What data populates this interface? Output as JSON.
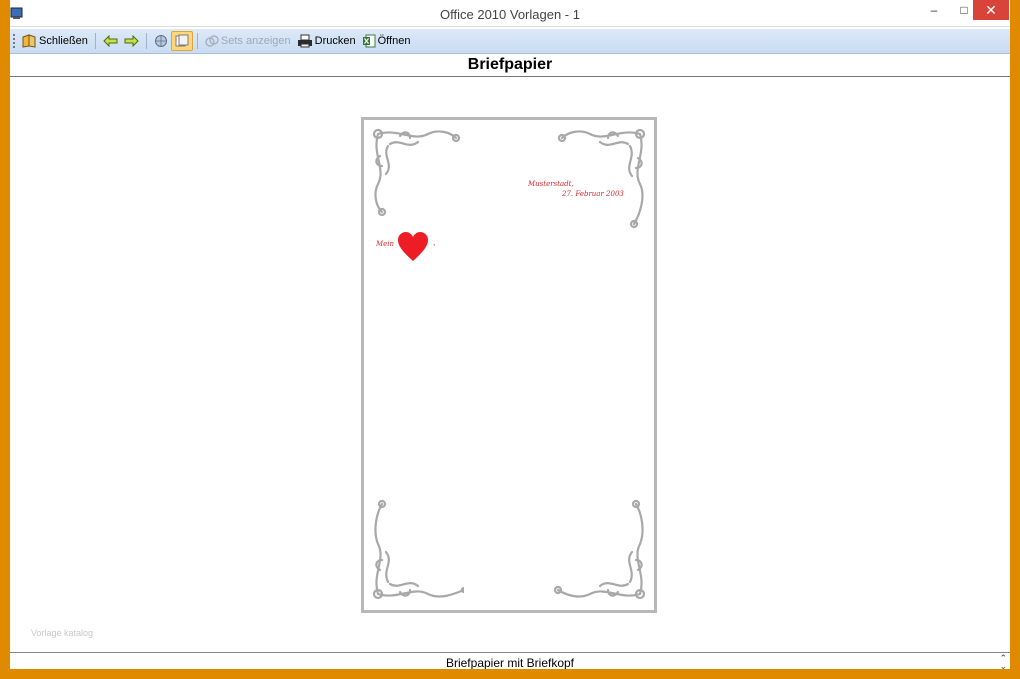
{
  "window": {
    "title": "Office 2010 Vorlagen - 1",
    "minimize_label": "–",
    "maximize_label": "□",
    "close_label": "✕"
  },
  "toolbar": {
    "close_label": "Schließen",
    "back_icon": "back-arrow-icon",
    "forward_icon": "forward-arrow-icon",
    "sets_label": "Sets anzeigen",
    "print_label": "Drucken",
    "open_label": "Öffnen"
  },
  "header": {
    "title": "Briefpapier"
  },
  "document": {
    "place": "Musterstadt,",
    "date": "27. Februar 2003",
    "greeting": "Mein",
    "comma": ","
  },
  "watermark": "Vorlage katalog",
  "status": {
    "text": "Briefpapier mit Briefkopf"
  },
  "colors": {
    "accent_red": "#d8282a",
    "frame": "#e08a00",
    "toolbar": "#dce9f8"
  }
}
